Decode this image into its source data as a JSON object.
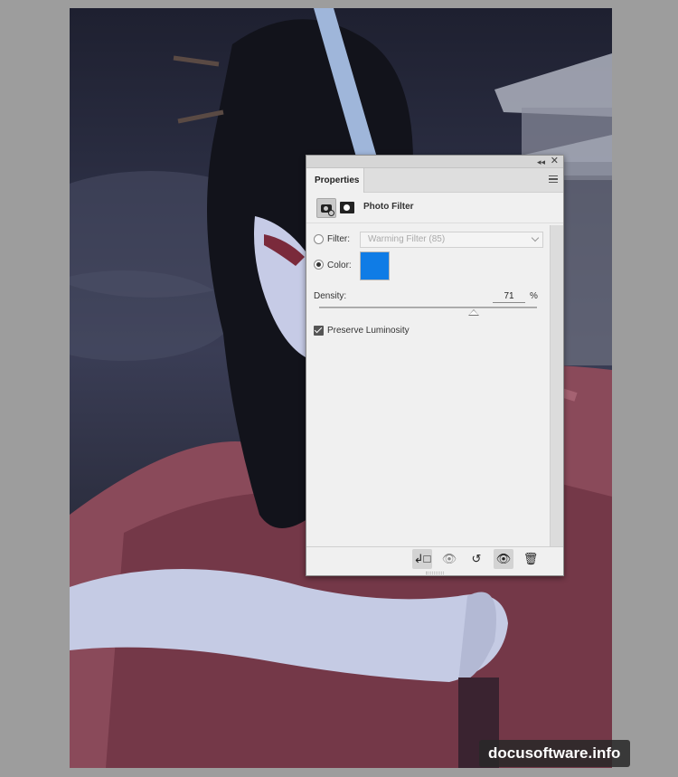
{
  "panel": {
    "tab_label": "Properties",
    "title": "Photo Filter",
    "filter_label": "Filter:",
    "filter_value": "Warming Filter (85)",
    "color_label": "Color:",
    "color_hex": "#0f7ce6",
    "mode_selected": "color",
    "density_label": "Density:",
    "density_value": "71",
    "density_unit": "%",
    "density_level": 0.71,
    "preserve_label": "Preserve Luminosity",
    "preserve_checked": true,
    "header_icons": [
      "collapse-icon",
      "close-icon",
      "panel-menu-icon"
    ],
    "footer_icons": [
      "clip-to-layer-icon",
      "view-previous-state-icon",
      "reset-icon",
      "visibility-icon",
      "delete-icon"
    ]
  },
  "watermark": "docusoftware.info"
}
